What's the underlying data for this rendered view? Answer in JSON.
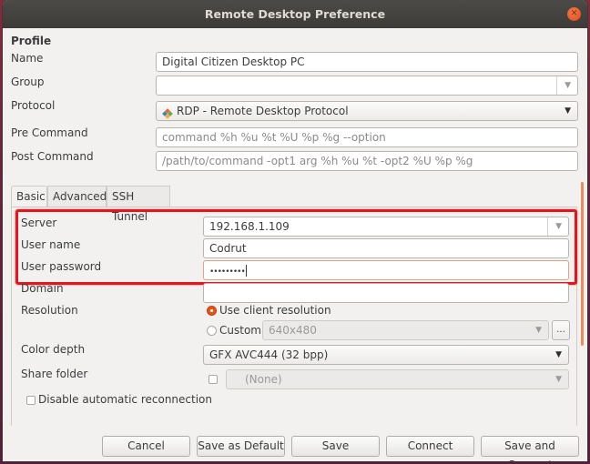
{
  "window": {
    "title": "Remote Desktop Preference",
    "close_icon": "close-icon"
  },
  "profile": {
    "section_label": "Profile",
    "name_label": "Name",
    "name_value": "Digital Citizen Desktop PC",
    "group_label": "Group",
    "group_value": "",
    "protocol_label": "Protocol",
    "protocol_value": "RDP - Remote Desktop Protocol",
    "protocol_icon": "rdp-plugin-icon",
    "pre_command_label": "Pre Command",
    "pre_command_placeholder": "command %h %u %t %U %p %g --option",
    "post_command_label": "Post Command",
    "post_command_placeholder": "/path/to/command -opt1 arg %h %u %t -opt2 %U %p %g"
  },
  "tabs": [
    {
      "label": "Basic",
      "active": true
    },
    {
      "label": "Advanced",
      "active": false
    },
    {
      "label": "SSH Tunnel",
      "active": false
    }
  ],
  "basic": {
    "server_label": "Server",
    "server_value": "192.168.1.109",
    "username_label": "User name",
    "username_value": "Codrut",
    "password_label": "User password",
    "password_mask": "•••••••••",
    "domain_label": "Domain",
    "domain_value": "",
    "resolution_label": "Resolution",
    "resolution_options": [
      {
        "label": "Use client resolution",
        "selected": true
      },
      {
        "label": "Custom",
        "selected": false
      }
    ],
    "custom_resolution_value": "640x480",
    "custom_resolution_more": "...",
    "color_depth_label": "Color depth",
    "color_depth_value": "GFX AVC444 (32 bpp)",
    "share_folder_label": "Share folder",
    "share_folder_checked": false,
    "share_folder_value": "(None)",
    "disable_reconnect_label": "Disable automatic reconnection",
    "disable_reconnect_checked": false
  },
  "buttons": {
    "cancel": "Cancel",
    "save_default": "Save as Default",
    "save": "Save",
    "connect": "Connect",
    "save_connect": "Save and Connect"
  },
  "colors": {
    "accent": "#e2541a",
    "highlight_box": "#e8141c",
    "titlebar": "#3c3b37"
  }
}
